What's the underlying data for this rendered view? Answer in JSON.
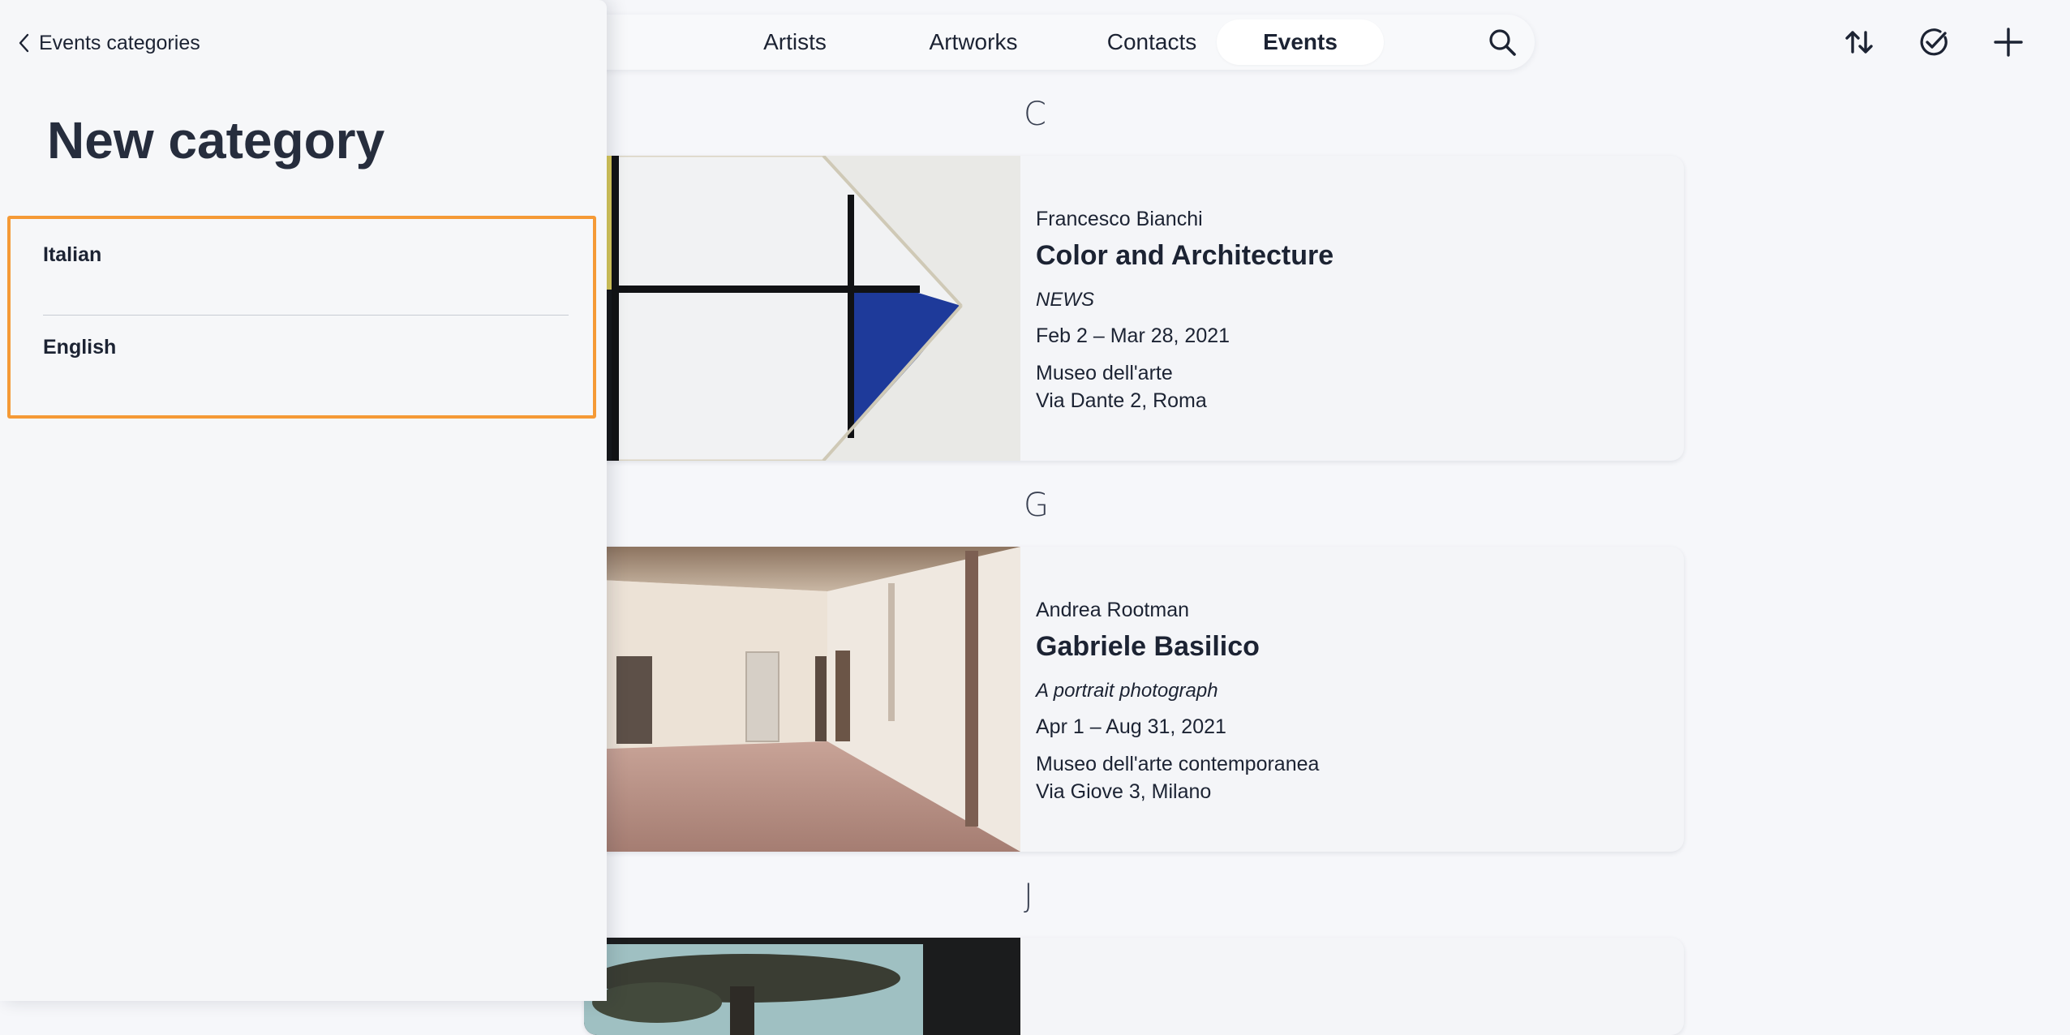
{
  "nav": {
    "tabs": [
      {
        "label": "Artists"
      },
      {
        "label": "Artworks"
      },
      {
        "label": "Contacts"
      },
      {
        "label": "Events",
        "active": true
      }
    ],
    "search_icon": "search-icon",
    "actions": [
      "sort-icon",
      "check-circle-icon",
      "plus-icon"
    ]
  },
  "events": {
    "groups": [
      {
        "letter": "C",
        "event": {
          "author": "Francesco Bianchi",
          "title": "Color and Architecture",
          "subtitle": "NEWS",
          "dates": "Feb 2 – Mar 28, 2021",
          "venue": "Museo dell'arte",
          "address": "Via Dante 2, Roma"
        }
      },
      {
        "letter": "G",
        "event": {
          "author": "Andrea Rootman",
          "title": "Gabriele Basilico",
          "subtitle": "A portrait photograph",
          "dates": "Apr 1 – Aug 31, 2021",
          "venue": "Museo dell'arte contemporanea",
          "address": "Via Giove 3, Milano"
        }
      },
      {
        "letter": "J",
        "event": {}
      }
    ]
  },
  "panel": {
    "back_label": "Events categories",
    "title": "New category",
    "fields": [
      {
        "label": "Italian",
        "value": ""
      },
      {
        "label": "English",
        "value": ""
      }
    ],
    "highlight_color": "#f59a36"
  }
}
